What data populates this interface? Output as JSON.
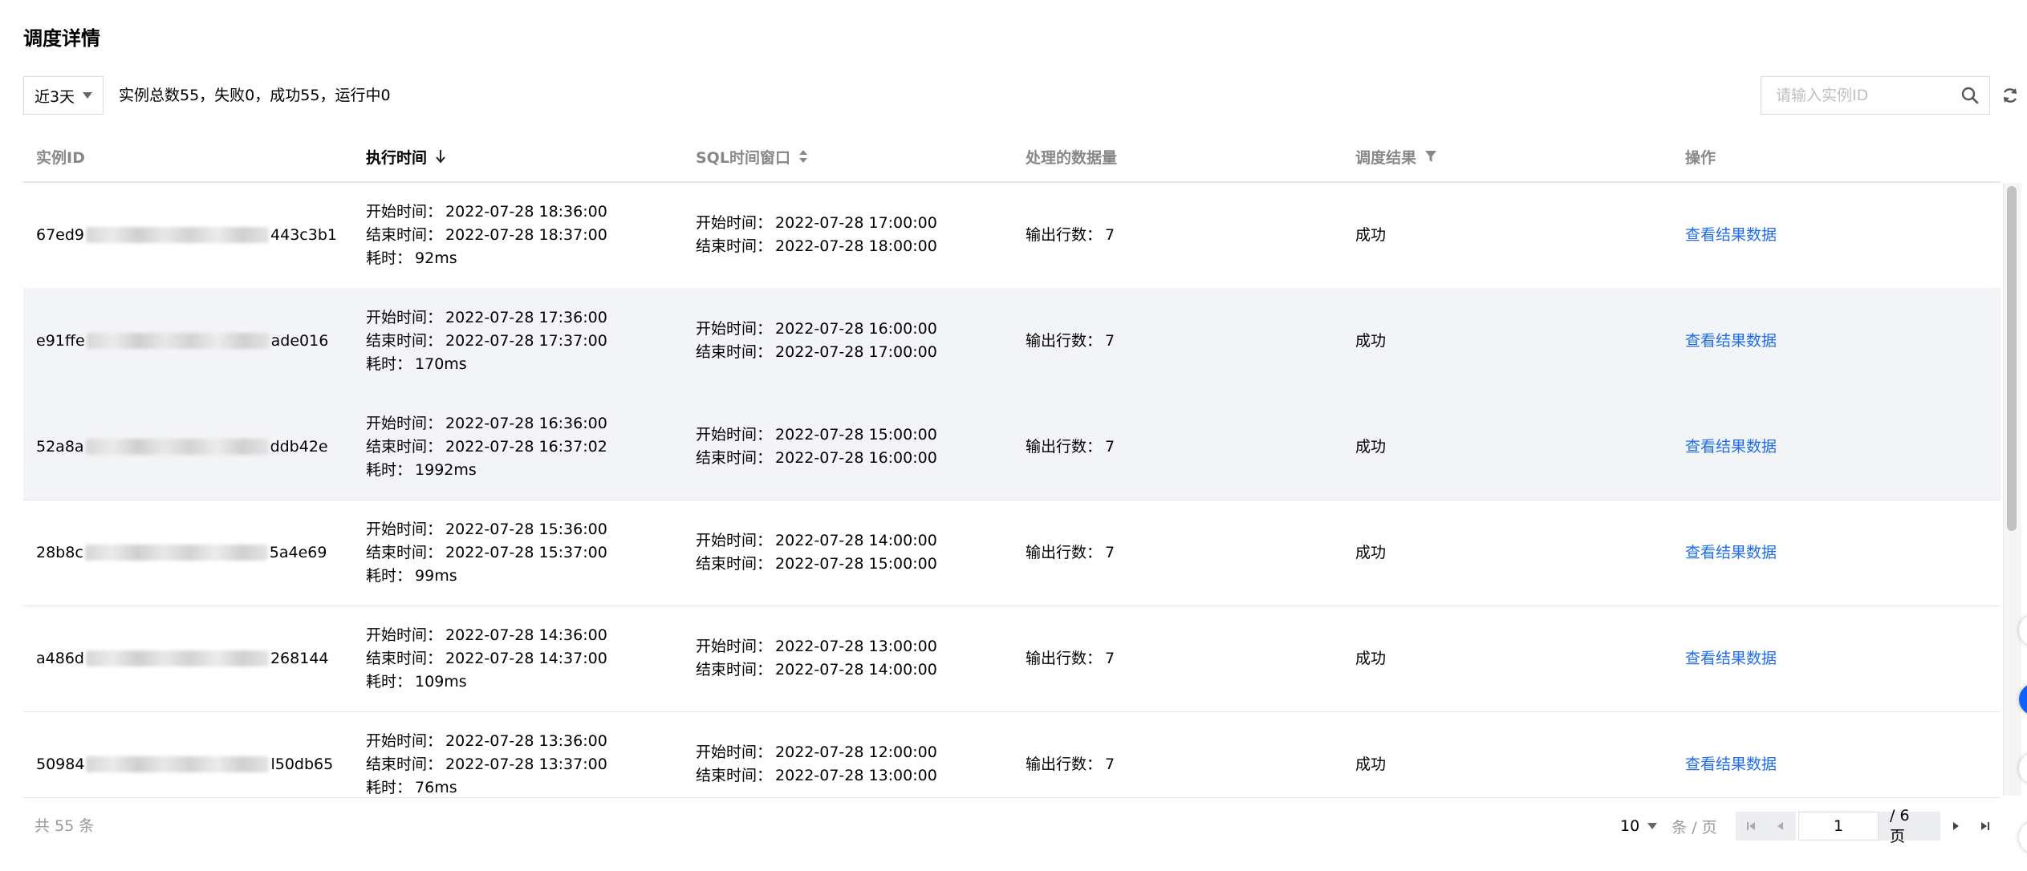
{
  "page": {
    "title": "调度详情"
  },
  "toolbar": {
    "range": "近3天",
    "summary": "实例总数55，失败0，成功55，运行中0",
    "search_placeholder": "请输入实例ID",
    "icons": {
      "search": "search-icon",
      "refresh": "refresh-icon",
      "dropdown": "caret-down-icon"
    }
  },
  "table": {
    "columns": [
      {
        "label": "实例ID"
      },
      {
        "label": "执行时间",
        "sort": "arrow-down-icon",
        "active": true
      },
      {
        "label": "SQL时间窗口",
        "sort": "sort-icon"
      },
      {
        "label": "处理的数据量"
      },
      {
        "label": "调度结果",
        "filter": "filter-icon"
      },
      {
        "label": "操作"
      }
    ],
    "labels": {
      "start": "开始时间：",
      "end": "结束时间：",
      "cost": "耗时：",
      "rows": "输出行数："
    },
    "rows": [
      {
        "id_prefix": "67ed9",
        "id_suffix": "443c3b1",
        "exec_start": "2022-07-28 18:36:00",
        "exec_end": "2022-07-28 18:37:00",
        "cost": "92ms",
        "win_start": "2022-07-28 17:00:00",
        "win_end": "2022-07-28 18:00:00",
        "rows_out": "7",
        "result": "成功",
        "action": "查看结果数据"
      },
      {
        "id_prefix": "e91ffe",
        "id_suffix": "ade016",
        "exec_start": "2022-07-28 17:36:00",
        "exec_end": "2022-07-28 17:37:00",
        "cost": "170ms",
        "win_start": "2022-07-28 16:00:00",
        "win_end": "2022-07-28 17:00:00",
        "rows_out": "7",
        "result": "成功",
        "action": "查看结果数据"
      },
      {
        "id_prefix": "52a8a",
        "id_suffix": "ddb42e",
        "exec_start": "2022-07-28 16:36:00",
        "exec_end": "2022-07-28 16:37:02",
        "cost": "1992ms",
        "win_start": "2022-07-28 15:00:00",
        "win_end": "2022-07-28 16:00:00",
        "rows_out": "7",
        "result": "成功",
        "action": "查看结果数据"
      },
      {
        "id_prefix": "28b8c",
        "id_suffix": "5a4e69",
        "exec_start": "2022-07-28 15:36:00",
        "exec_end": "2022-07-28 15:37:00",
        "cost": "99ms",
        "win_start": "2022-07-28 14:00:00",
        "win_end": "2022-07-28 15:00:00",
        "rows_out": "7",
        "result": "成功",
        "action": "查看结果数据"
      },
      {
        "id_prefix": "a486d",
        "id_suffix": "268144",
        "exec_start": "2022-07-28 14:36:00",
        "exec_end": "2022-07-28 14:37:00",
        "cost": "109ms",
        "win_start": "2022-07-28 13:00:00",
        "win_end": "2022-07-28 14:00:00",
        "rows_out": "7",
        "result": "成功",
        "action": "查看结果数据"
      },
      {
        "id_prefix": "50984",
        "id_suffix": "l50db65",
        "exec_start": "2022-07-28 13:36:00",
        "exec_end": "2022-07-28 13:37:00",
        "cost": "76ms",
        "win_start": "2022-07-28 12:00:00",
        "win_end": "2022-07-28 13:00:00",
        "rows_out": "7",
        "result": "成功",
        "action": "查看结果数据"
      }
    ]
  },
  "footer": {
    "total": "共 55 条",
    "page_size": "10",
    "page_size_unit": "条 / 页",
    "current_page": "1",
    "total_pages": "/ 6 页",
    "icons": {
      "first": "first-page-icon",
      "prev": "prev-page-icon",
      "next": "next-page-icon",
      "last": "last-page-icon"
    }
  },
  "colors": {
    "link": "#1f6ee8",
    "row_highlight": "#f3f4f7",
    "muted_text": "#888888",
    "border": "#e6e6e6",
    "edge_button": "#0f62fe"
  }
}
